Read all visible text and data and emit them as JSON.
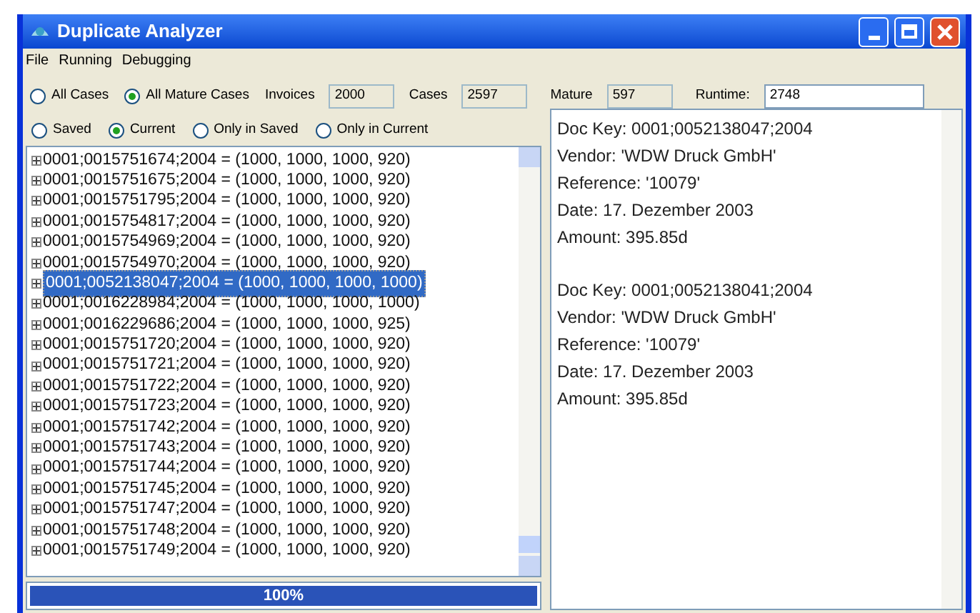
{
  "window": {
    "title": "Duplicate Analyzer"
  },
  "menu": [
    "File",
    "Running",
    "Debugging"
  ],
  "case_filter": [
    {
      "label": "All Cases",
      "selected": false
    },
    {
      "label": "All Mature Cases",
      "selected": true
    }
  ],
  "stats": [
    {
      "label": "Invoices",
      "value": "2000",
      "editable": false
    },
    {
      "label": "Cases",
      "value": "2597",
      "editable": false
    },
    {
      "label": "Mature",
      "value": "597",
      "editable": false
    },
    {
      "label": "Runtime:",
      "value": "2748",
      "editable": true
    }
  ],
  "view_filter": [
    {
      "label": "Saved",
      "selected": false
    },
    {
      "label": "Current",
      "selected": true
    },
    {
      "label": "Only in Saved",
      "selected": false
    },
    {
      "label": "Only in Current",
      "selected": false
    }
  ],
  "cases": [
    {
      "text": "0001;0015751674;2004 = (1000, 1000, 1000, 920)",
      "selected": false
    },
    {
      "text": "0001;0015751675;2004 = (1000, 1000, 1000, 920)",
      "selected": false
    },
    {
      "text": "0001;0015751795;2004 = (1000, 1000, 1000, 920)",
      "selected": false
    },
    {
      "text": "0001;0015754817;2004 = (1000, 1000, 1000, 920)",
      "selected": false
    },
    {
      "text": "0001;0015754969;2004 = (1000, 1000, 1000, 920)",
      "selected": false
    },
    {
      "text": "0001;0015754970;2004 = (1000, 1000, 1000, 920)",
      "selected": false
    },
    {
      "text": "0001;0052138047;2004 = (1000, 1000, 1000, 1000)",
      "selected": true
    },
    {
      "text": "0001;0016228984;2004 = (1000, 1000, 1000, 1000)",
      "selected": false
    },
    {
      "text": "0001;0016229686;2004 = (1000, 1000, 1000, 925)",
      "selected": false
    },
    {
      "text": "0001;0015751720;2004 = (1000, 1000, 1000, 920)",
      "selected": false
    },
    {
      "text": "0001;0015751721;2004 = (1000, 1000, 1000, 920)",
      "selected": false
    },
    {
      "text": "0001;0015751722;2004 = (1000, 1000, 1000, 920)",
      "selected": false
    },
    {
      "text": "0001;0015751723;2004 = (1000, 1000, 1000, 920)",
      "selected": false
    },
    {
      "text": "0001;0015751742;2004 = (1000, 1000, 1000, 920)",
      "selected": false
    },
    {
      "text": "0001;0015751743;2004 = (1000, 1000, 1000, 920)",
      "selected": false
    },
    {
      "text": "0001;0015751744;2004 = (1000, 1000, 1000, 920)",
      "selected": false
    },
    {
      "text": "0001;0015751745;2004 = (1000, 1000, 1000, 920)",
      "selected": false
    },
    {
      "text": "0001;0015751747;2004 = (1000, 1000, 1000, 920)",
      "selected": false
    },
    {
      "text": "0001;0015751748;2004 = (1000, 1000, 1000, 920)",
      "selected": false
    },
    {
      "text": "0001;0015751749;2004 = (1000, 1000, 1000, 920)",
      "selected": false
    }
  ],
  "progress": {
    "level": 1,
    "label": "100%"
  },
  "details": [
    [
      "Doc Key: 0001;0052138047;2004",
      "Vendor: 'WDW Druck GmbH'",
      "Reference: '10079'",
      "Date: 17. Dezember 2003",
      "Amount: 395.85d"
    ],
    [
      "Doc Key: 0001;0052138041;2004",
      "Vendor: 'WDW Druck GmbH'",
      "Reference: '10079'",
      "Date: 17. Dezember 2003",
      "Amount: 395.85d"
    ]
  ]
}
